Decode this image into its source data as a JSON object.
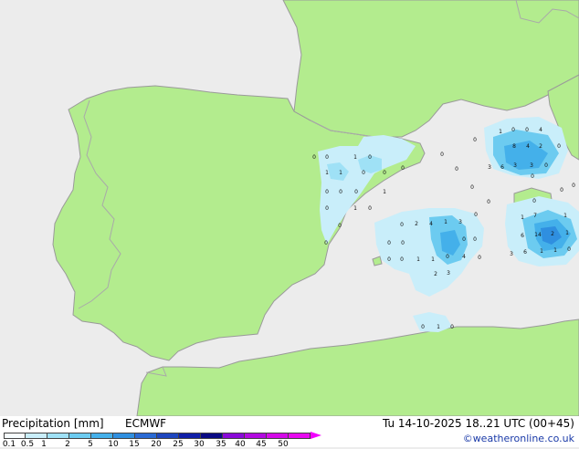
{
  "map": {
    "colors": {
      "sea": "#ececec",
      "land": "#b3ec8e",
      "coast": "#9a9a9a",
      "border": "#a9a9a9"
    },
    "markers": [
      {
        "label": "0"
      },
      {
        "label": "0"
      },
      {
        "label": "1"
      },
      {
        "label": "0"
      },
      {
        "label": "1"
      },
      {
        "label": "1"
      },
      {
        "label": "0"
      },
      {
        "label": "0"
      },
      {
        "label": "0"
      },
      {
        "label": "0"
      },
      {
        "label": "0"
      },
      {
        "label": "1"
      },
      {
        "label": "0"
      },
      {
        "label": "1"
      },
      {
        "label": "0"
      },
      {
        "label": "0"
      },
      {
        "label": "0"
      },
      {
        "label": "0"
      },
      {
        "label": "0"
      },
      {
        "label": "0"
      },
      {
        "label": "0"
      },
      {
        "label": "0"
      },
      {
        "label": "0"
      },
      {
        "label": "0"
      },
      {
        "label": "0"
      },
      {
        "label": "2"
      },
      {
        "label": "4"
      },
      {
        "label": "1"
      },
      {
        "label": "3"
      },
      {
        "label": "0"
      },
      {
        "label": "0"
      },
      {
        "label": "0"
      },
      {
        "label": "4"
      },
      {
        "label": "0"
      },
      {
        "label": "0"
      },
      {
        "label": "0"
      },
      {
        "label": "1"
      },
      {
        "label": "1"
      },
      {
        "label": "0"
      },
      {
        "label": "3"
      },
      {
        "label": "2"
      },
      {
        "label": "0"
      },
      {
        "label": "0"
      },
      {
        "label": "1"
      },
      {
        "label": "0"
      },
      {
        "label": "1"
      },
      {
        "label": "0"
      },
      {
        "label": "0"
      },
      {
        "label": "4"
      },
      {
        "label": "8"
      },
      {
        "label": "4"
      },
      {
        "label": "2"
      },
      {
        "label": "0"
      },
      {
        "label": "3"
      },
      {
        "label": "6"
      },
      {
        "label": "3"
      },
      {
        "label": "3"
      },
      {
        "label": "0"
      },
      {
        "label": "0"
      },
      {
        "label": "0"
      },
      {
        "label": "1"
      },
      {
        "label": "7"
      },
      {
        "label": "1"
      },
      {
        "label": "6"
      },
      {
        "label": "14"
      },
      {
        "label": "2"
      },
      {
        "label": "1"
      },
      {
        "label": "3"
      },
      {
        "label": "6"
      },
      {
        "label": "1"
      },
      {
        "label": "1"
      },
      {
        "label": "0"
      },
      {
        "label": "0"
      },
      {
        "label": "0"
      }
    ]
  },
  "footer": {
    "title": "Precipitation [mm]",
    "model": "ECMWF",
    "time": "Tu 14-10-2025 18..21 UTC (00+45)",
    "credit": "©weatheronline.co.uk"
  },
  "legend": {
    "swatches": [
      "#f6fcfe",
      "#c9eefa",
      "#9fe1f6",
      "#6ccbf0",
      "#44b0ea",
      "#2f8fe0",
      "#2a6ad4",
      "#1e46bf",
      "#101fa8",
      "#0a0a84",
      "#8a0ad8",
      "#b20ae0",
      "#d40ae8",
      "#e80af0"
    ],
    "ticks": [
      "0.1",
      "0.5",
      "1",
      "2",
      "5",
      "10",
      "15",
      "20",
      "25",
      "30",
      "35",
      "40",
      "45",
      "50"
    ]
  }
}
